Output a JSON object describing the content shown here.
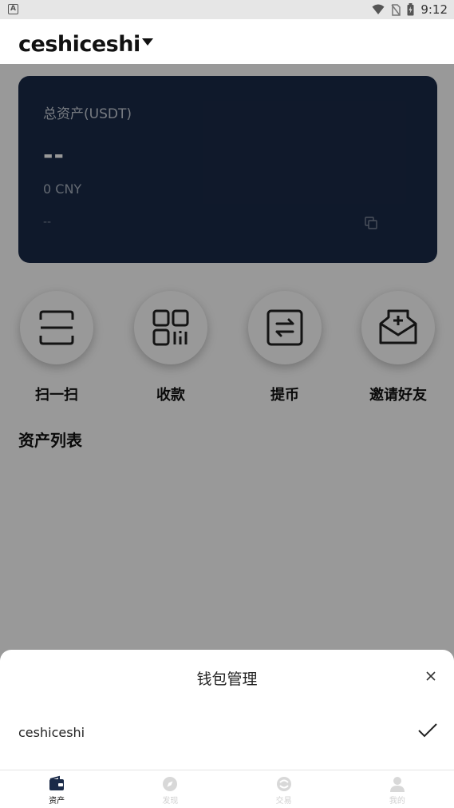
{
  "status_bar": {
    "time": "9:12",
    "app_icon_letter": "A"
  },
  "header": {
    "wallet_name": "ceshiceshi"
  },
  "asset_card": {
    "label": "总资产(USDT)",
    "total_value": "--",
    "cny_value": "0 CNY",
    "address": "--"
  },
  "actions": [
    {
      "label": "扫一扫",
      "icon": "scan-icon"
    },
    {
      "label": "收款",
      "icon": "qr-code-icon"
    },
    {
      "label": "提币",
      "icon": "transfer-icon"
    },
    {
      "label": "邀请好友",
      "icon": "invite-mail-icon"
    }
  ],
  "section": {
    "title": "资产列表"
  },
  "sheet": {
    "title": "钱包管理",
    "wallets": [
      {
        "name": "ceshiceshi",
        "selected": true
      }
    ]
  },
  "bottom_nav": [
    {
      "label": "资产",
      "icon": "wallet-icon",
      "active": true
    },
    {
      "label": "发现",
      "icon": "compass-icon",
      "active": false
    },
    {
      "label": "交易",
      "icon": "exchange-icon",
      "active": false
    },
    {
      "label": "我的",
      "icon": "user-icon",
      "active": false
    }
  ],
  "colors": {
    "card_bg": "#1a2a48",
    "overlay": "rgba(0,0,0,0.4)",
    "active_tab": "#1a2a48"
  }
}
